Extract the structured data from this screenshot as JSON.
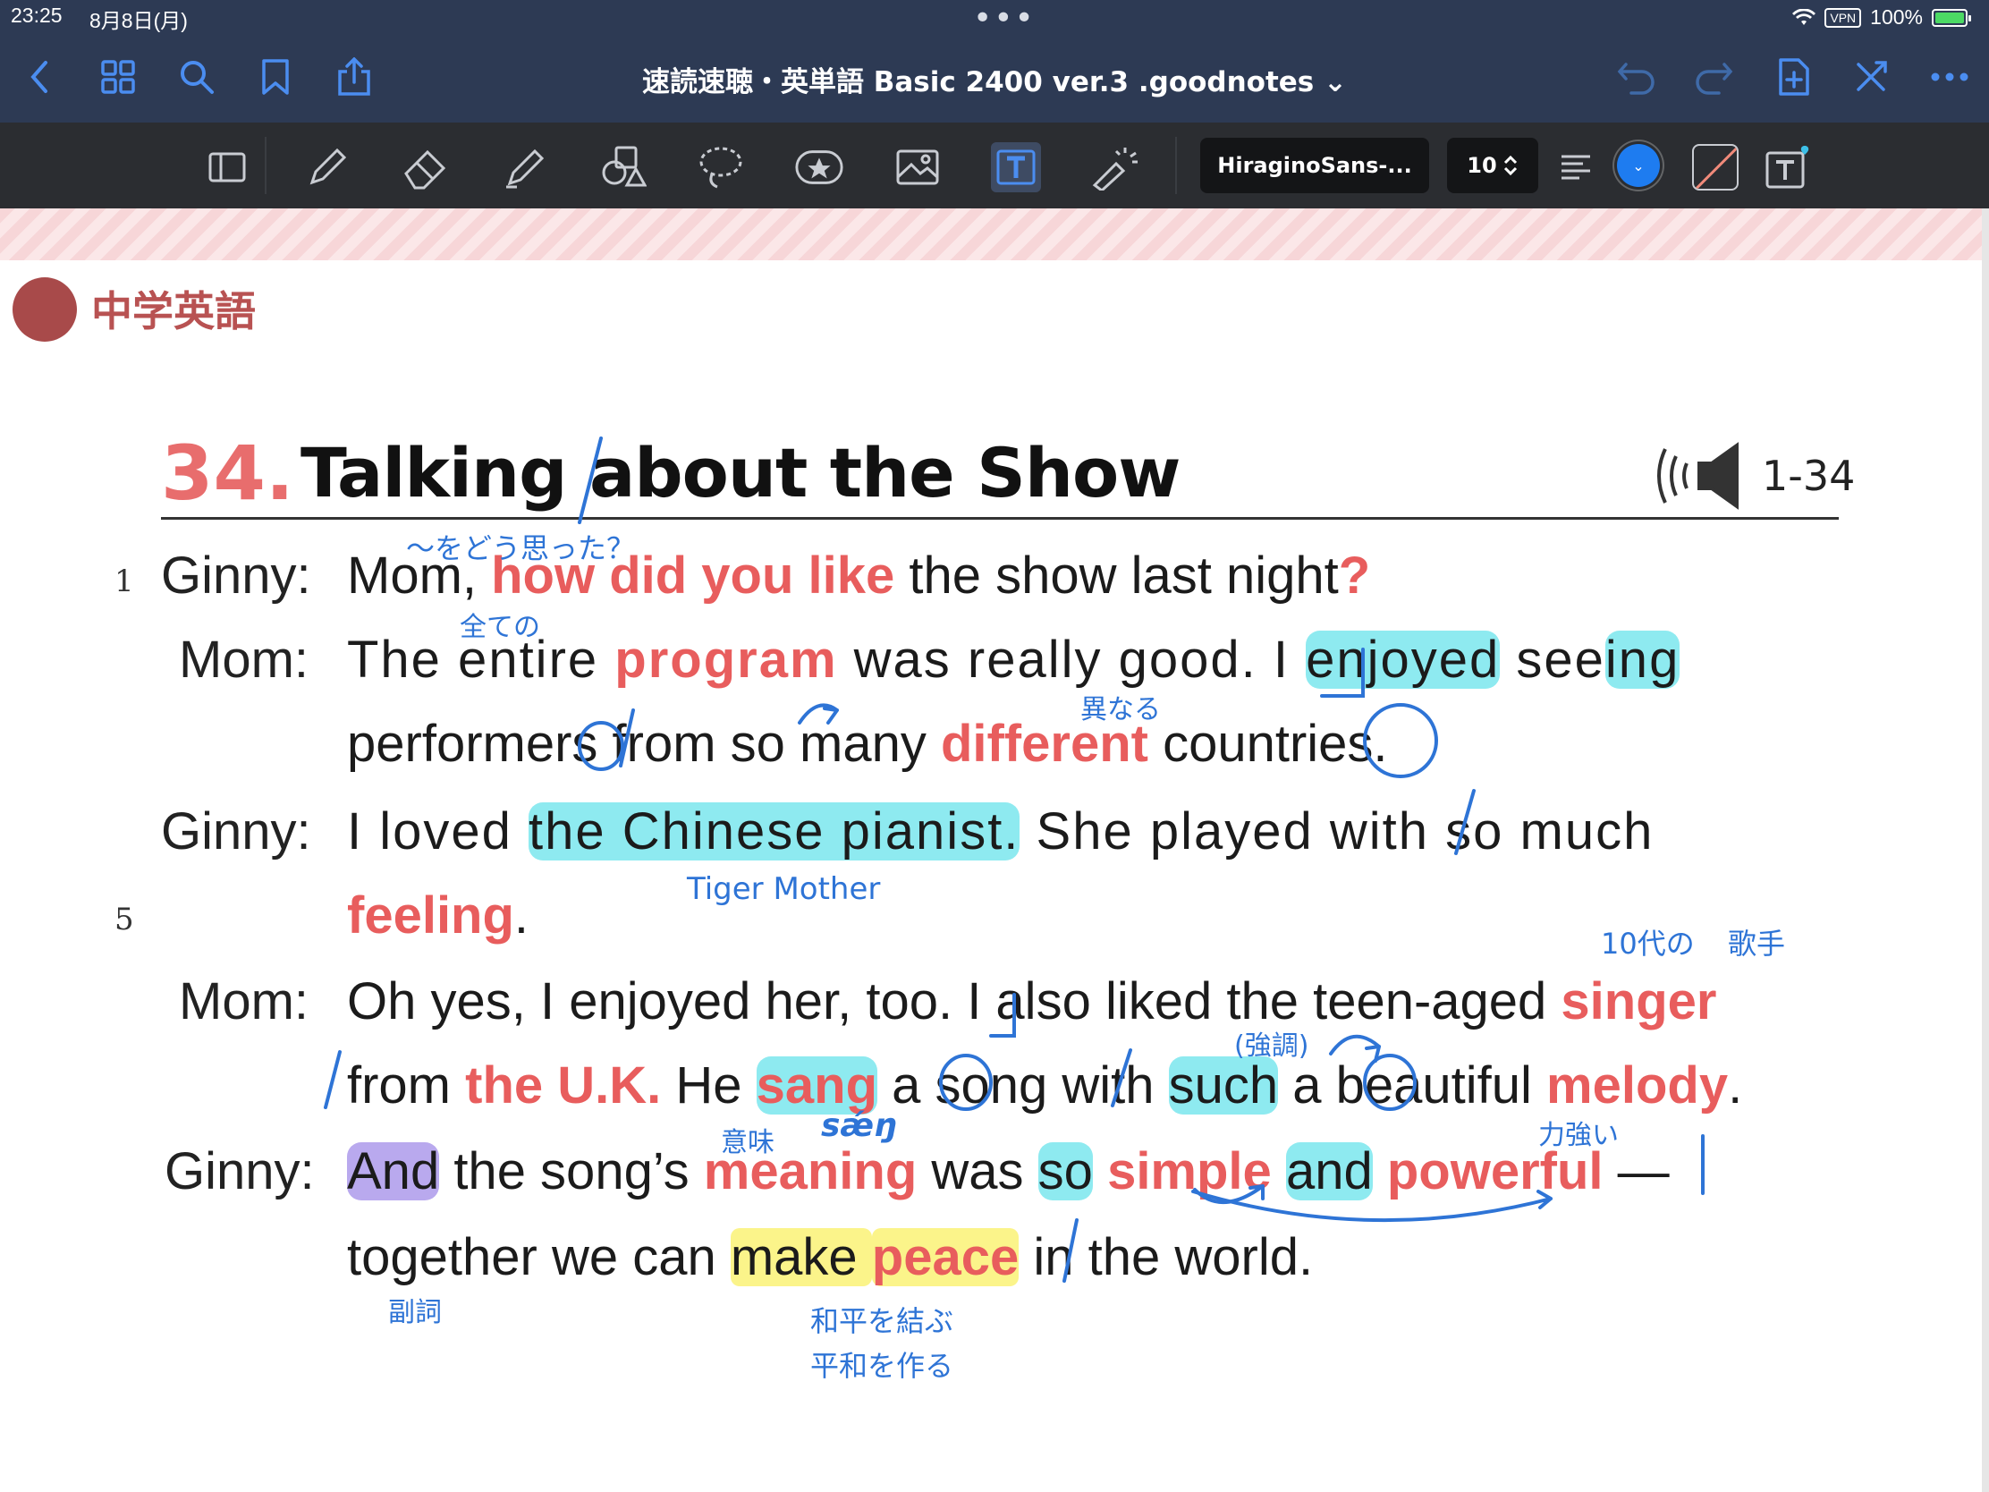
{
  "status": {
    "time": "23:25",
    "date": "8月8日(月)",
    "vpn": "VPN",
    "battery": "100%"
  },
  "nav": {
    "title": "速読速聴・英単語 Basic 2400 ver.3 .goodnotes ⌄"
  },
  "toolbar": {
    "font": "HiraginoSans-...",
    "size": "10"
  },
  "book": {
    "label": "中学英語"
  },
  "lesson": {
    "number": "34.",
    "title": "Talking about the Show",
    "track": "1-34"
  },
  "line_numbers": {
    "one": "1",
    "five": "5"
  },
  "speakers": {
    "ginny": "Ginny:",
    "mom": "Mom:"
  },
  "text": {
    "l1_a": "Mom, ",
    "l1_red": "how did you like",
    "l1_b": " the show last night",
    "l1_q": "?",
    "l2_a": "The entire ",
    "l2_red": "program",
    "l2_b": " was really good.  I ",
    "l2_hl1": "enjoyed",
    "l2_c": " see",
    "l2_hl2": "ing",
    "l3_a": "performers from so many ",
    "l3_red": "different",
    "l3_b": " countries.",
    "l4_a": "I loved ",
    "l4_hl": "the Chinese pianist.",
    "l4_b": "  She played with so much",
    "l5_red": "feeling",
    "l5_b": ".",
    "l6_a": "Oh yes, I enjoyed her, too.  I also liked the teen-aged ",
    "l6_red": "singer",
    "l7_a": "from ",
    "l7_red1": "the U.K.",
    "l7_b": "  He ",
    "l7_hl": "sang",
    "l7_c": " a song with ",
    "l7_hl2": "such",
    "l7_d": " a beautiful ",
    "l7_red2": "melody",
    "l7_e": ".",
    "l8_hl": "And",
    "l8_a": " the song’s ",
    "l8_red1": "meaning",
    "l8_b": " was ",
    "l8_hl2": "so",
    "l8_c": " ",
    "l8_red2": "simple",
    "l8_d": " ",
    "l8_hl3": "and",
    "l8_e": " ",
    "l8_red3": "powerful",
    "l8_f": "  —",
    "l9_a": "together we can ",
    "l9_hl": "make ",
    "l9_hlred": "peace",
    "l9_b": " in the world."
  },
  "notes": {
    "n1": "〜をどう思った？",
    "n2": "全ての",
    "n3": "異なる",
    "n4": "Tiger Mother",
    "n5": "10代の",
    "n6": "歌手",
    "n7": "(強調)",
    "n8": "意味",
    "n9": "sǽŋ",
    "n10": "力強い",
    "n11": "副詞",
    "n12": "和平を結ぶ",
    "n13": "平和を作る"
  },
  "colors": {
    "nav_bg": "#2d3a54",
    "toolbar_bg": "#2b2d31",
    "accent_red": "#e85d5d",
    "ink_blue": "#2e74d6",
    "highlight_cyan": "#8eeaf0"
  },
  "icons": [
    "back-icon",
    "grid-icon",
    "search-icon",
    "bookmark-icon",
    "share-icon",
    "undo-icon",
    "redo-icon",
    "add-page-icon",
    "close-toolbar-icon",
    "more-icon",
    "read-mode-icon",
    "pen-icon",
    "eraser-icon",
    "highlighter-icon",
    "shapes-icon",
    "lasso-icon",
    "sticker-icon",
    "image-icon",
    "text-tool-icon",
    "laser-icon",
    "align-icon",
    "text-box-icon",
    "speaker-icon"
  ]
}
